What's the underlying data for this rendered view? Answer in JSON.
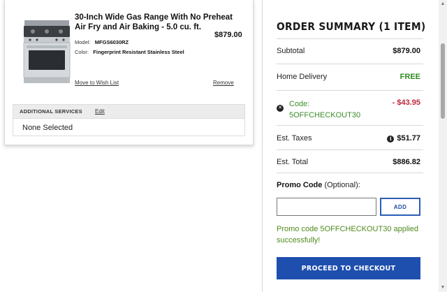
{
  "cart": {
    "product": {
      "title": "30-Inch Wide Gas Range With No Preheat Air Fry and Air Baking - 5.0 cu. ft.",
      "price": "$879.00",
      "model_label": "Model:",
      "model_value": "MFGS6030RZ",
      "color_label": "Color:",
      "color_value": "Fingerprint Resistant Stainless Steel",
      "wishlist_link": "Move to Wish List",
      "remove_link": "Remove"
    },
    "services": {
      "header": "ADDITIONAL SERVICES",
      "edit_link": "Edit",
      "value": "None Selected"
    }
  },
  "summary": {
    "title": "ORDER SUMMARY (1 ITEM)",
    "subtotal_label": "Subtotal",
    "subtotal_value": "$879.00",
    "delivery_label": "Home Delivery",
    "delivery_value": "FREE",
    "coupon_label_line1": "Code:",
    "coupon_code": "5OFFCHECKOUT30",
    "coupon_value": "- $43.95",
    "taxes_label": "Est. Taxes",
    "taxes_value": "$51.77",
    "total_label": "Est. Total",
    "total_value": "$886.82",
    "promo_label": "Promo Code",
    "promo_optional": " (Optional):",
    "promo_input_value": "",
    "promo_input_placeholder": "",
    "add_button": "ADD",
    "promo_message": "Promo code 5OFFCHECKOUT30 applied successfully!",
    "checkout_button": "PROCEED TO CHECKOUT"
  },
  "colors": {
    "accent_blue": "#1e4fae",
    "success_green": "#2d8a20",
    "discount_red": "#c0263a"
  },
  "icons": {
    "remove_coupon": "close-circle-icon",
    "tax_info": "info-icon"
  }
}
